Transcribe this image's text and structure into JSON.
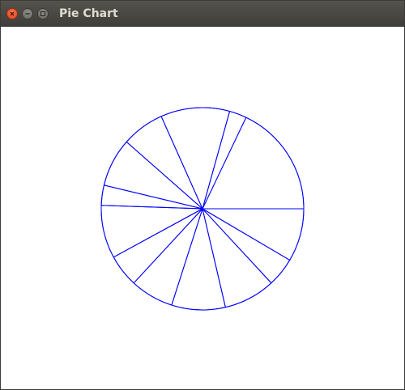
{
  "window": {
    "title": "Pie Chart",
    "controls": [
      "close-icon",
      "minimize-icon",
      "maximize-icon"
    ]
  },
  "colors": {
    "titlebar": "#3f3e3a",
    "title_text": "#dfdbd2",
    "close_button": "#e0431e",
    "slice_stroke": "#0000ff",
    "canvas_background": "#ffffff"
  },
  "chart_data": {
    "type": "pie",
    "title": "",
    "fill": "none",
    "stroke": "#0000ff",
    "values": [
      8.48,
      4.64,
      8.24,
      8.57,
      6.94,
      5.18,
      8.49,
      3.2,
      7.75,
      6.83,
      11.0,
      2.76,
      17.92
    ],
    "start_angle_deg": 0,
    "direction": "clockwise"
  }
}
